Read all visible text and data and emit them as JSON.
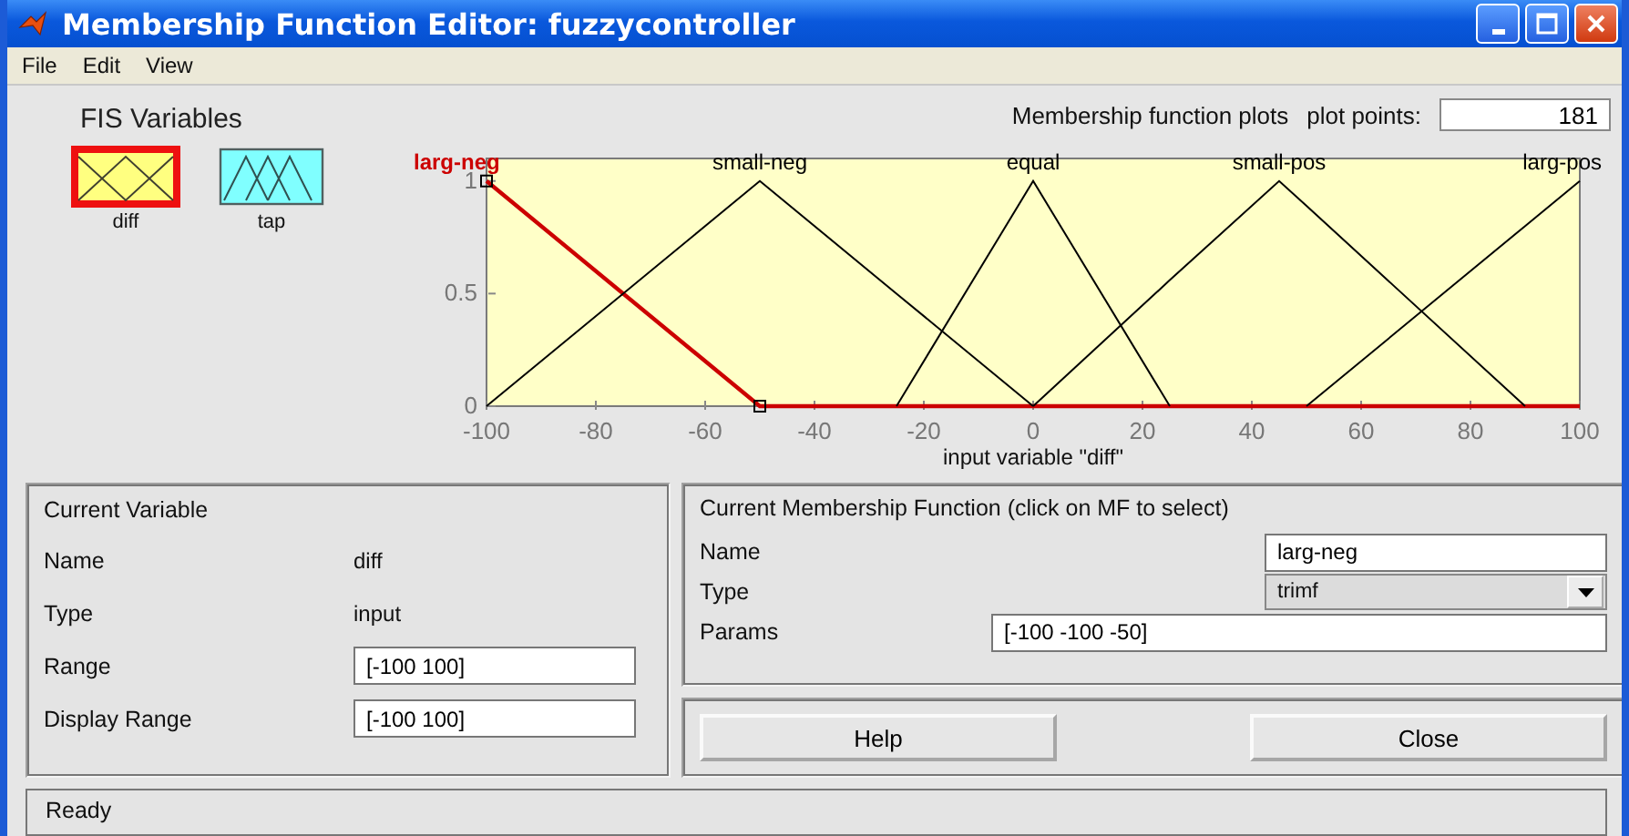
{
  "window": {
    "title": "Membership Function Editor: fuzzycontroller"
  },
  "menu": [
    "File",
    "Edit",
    "View"
  ],
  "fis_variables": {
    "title": "FIS Variables",
    "items": [
      {
        "label": "diff",
        "kind": "input",
        "selected": true
      },
      {
        "label": "tap",
        "kind": "output",
        "selected": false
      }
    ]
  },
  "plot_header": {
    "title": "Membership function plots",
    "plot_points_label": "plot points:",
    "plot_points": "181"
  },
  "chart_data": {
    "type": "line",
    "xlabel": "input variable \"diff\"",
    "x": [
      -100,
      -50,
      -25,
      0,
      25,
      45,
      50,
      90,
      100
    ],
    "series": [
      {
        "name": "larg-neg",
        "color": "#cc0000",
        "values": [
          1,
          0,
          0,
          0,
          0,
          0,
          0,
          0,
          0
        ]
      },
      {
        "name": "small-neg",
        "color": "#000000",
        "values": [
          0,
          1,
          0.5,
          0,
          null,
          null,
          null,
          null,
          null
        ]
      },
      {
        "name": "equal",
        "color": "#000000",
        "values": [
          null,
          null,
          0,
          1,
          0,
          null,
          null,
          null,
          null
        ]
      },
      {
        "name": "small-pos",
        "color": "#000000",
        "values": [
          null,
          null,
          null,
          0,
          0.56,
          1,
          0.89,
          0,
          null
        ]
      },
      {
        "name": "larg-pos",
        "color": "#000000",
        "values": [
          null,
          null,
          null,
          null,
          null,
          null,
          0,
          0.8,
          1
        ]
      }
    ],
    "xlim": [
      -100,
      100
    ],
    "ylim": [
      0,
      1.1
    ],
    "xticks": [
      -100,
      -80,
      -60,
      -40,
      -20,
      0,
      20,
      40,
      60,
      80,
      100
    ],
    "yticks": [
      0,
      0.5,
      1
    ]
  },
  "current_variable": {
    "title": "Current Variable",
    "rows": [
      {
        "label": "Name",
        "kind": "text",
        "value": "diff"
      },
      {
        "label": "Type",
        "kind": "text",
        "value": "input"
      },
      {
        "label": "Range",
        "kind": "field",
        "value": "[-100 100]"
      },
      {
        "label": "Display Range",
        "kind": "field",
        "value": "[-100 100]"
      }
    ]
  },
  "current_mf": {
    "title": "Current Membership Function (click on MF to select)",
    "name_label": "Name",
    "name": "larg-neg",
    "type_label": "Type",
    "type": "trimf",
    "params_label": "Params",
    "params": "[-100 -100 -50]"
  },
  "buttons": [
    "Help",
    "Close"
  ],
  "status_bar": "Ready"
}
